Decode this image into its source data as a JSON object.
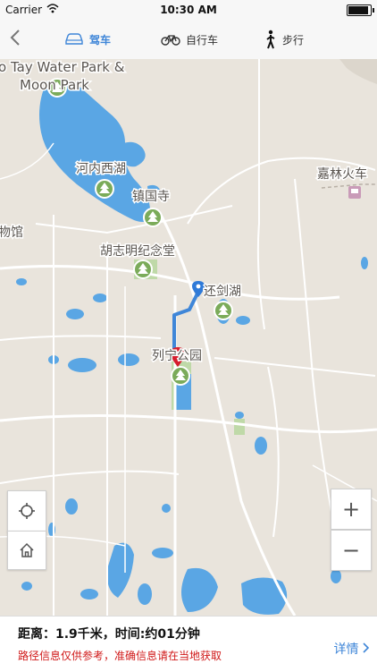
{
  "status_bar": {
    "carrier": "Carrier",
    "time": "10:30 AM"
  },
  "nav": {
    "tabs": [
      {
        "label": "驾车",
        "icon": "car-icon",
        "active": true
      },
      {
        "label": "自行车",
        "icon": "bicycle-icon",
        "active": false
      },
      {
        "label": "步行",
        "icon": "walking-icon",
        "active": false
      }
    ]
  },
  "map": {
    "labels": {
      "water_park": "o Tay Water Park &",
      "moon_park": "Moon Park",
      "west_lake": "河内西湖",
      "pagoda": "镇国寺",
      "museum": "物馆",
      "mausoleum": "胡志明纪念堂",
      "sword_lake": "还剑湖",
      "station": "嘉林火车",
      "lenin_park": "列宁公园"
    },
    "colors": {
      "water": "#5aa6e4",
      "land": "#e9e4dc",
      "park": "#bfd9a8",
      "route": "#3f86d8",
      "poi": "#7bab5a",
      "start_pin": "#2f7ad8",
      "end_pin": "#d61d2d"
    }
  },
  "controls": {
    "zoom_in": "+",
    "zoom_out": "−"
  },
  "bottom": {
    "distance": "距离：1.9千米，时间:约01分钟",
    "note": "路径信息仅供参考，准确信息请在当地获取",
    "details": "详情"
  }
}
